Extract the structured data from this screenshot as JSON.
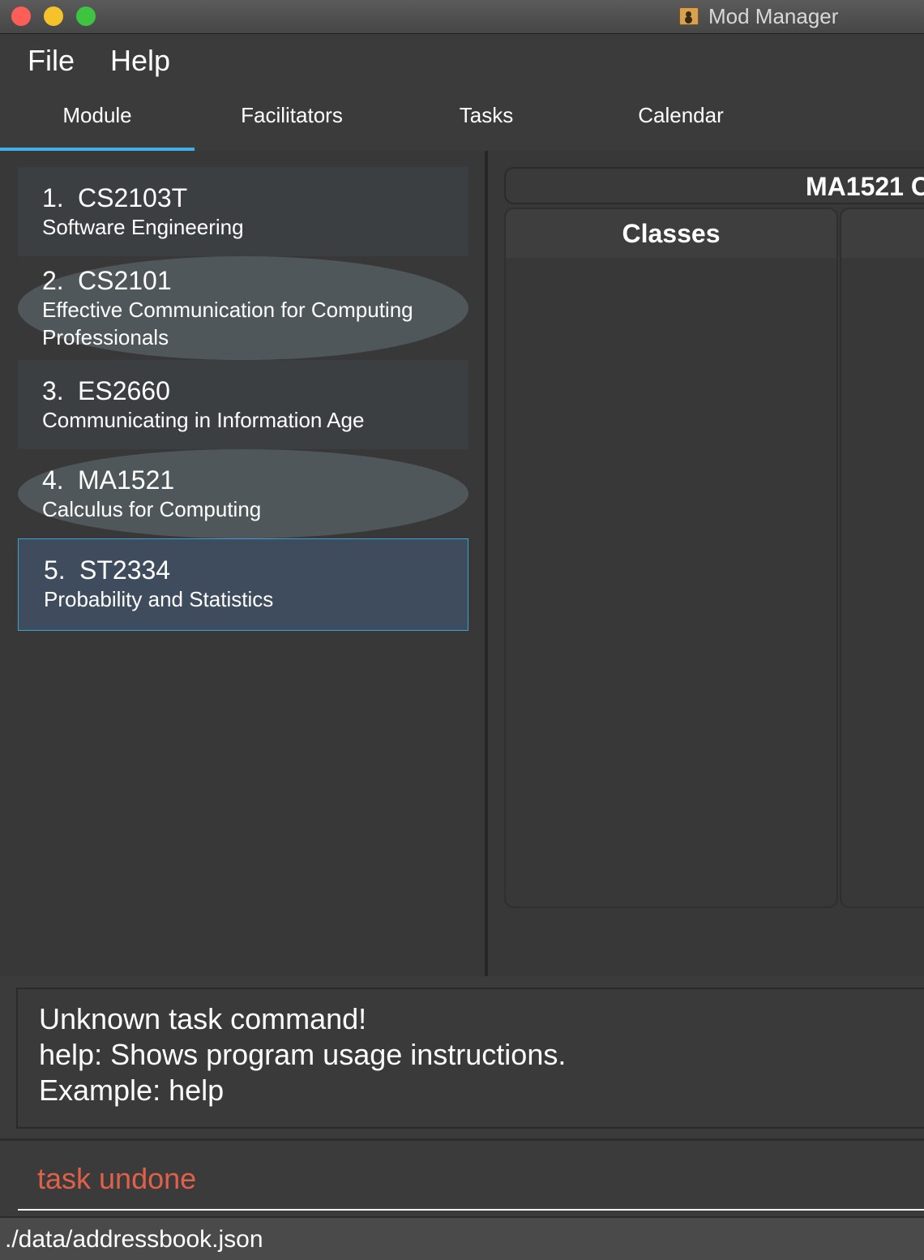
{
  "window": {
    "title": "Mod Manager",
    "app_icon": "contacts-book-icon"
  },
  "menubar": {
    "items": [
      "File",
      "Help"
    ]
  },
  "tabs": [
    {
      "label": "Module",
      "active": true
    },
    {
      "label": "Facilitators",
      "active": false
    },
    {
      "label": "Tasks",
      "active": false
    },
    {
      "label": "Calendar",
      "active": false
    }
  ],
  "module_list": [
    {
      "index": "1.",
      "code": "CS2103T",
      "name": "Software Engineering"
    },
    {
      "index": "2.",
      "code": "CS2101",
      "name": "Effective Communication for Computing Professionals"
    },
    {
      "index": "3.",
      "code": "ES2660",
      "name": "Communicating in Information Age"
    },
    {
      "index": "4.",
      "code": "MA1521",
      "name": "Calculus for Computing"
    },
    {
      "index": "5.",
      "code": "ST2334",
      "name": "Probability and Statistics",
      "selected": true
    }
  ],
  "detail": {
    "header": "MA1521 C",
    "classes_header": "Classes"
  },
  "result": {
    "lines": [
      "Unknown task command!",
      "help: Shows program usage instructions.",
      "Example: help"
    ]
  },
  "command": {
    "value": "task undone",
    "color": "#e0614a"
  },
  "status": {
    "path": "./data/addressbook.json"
  },
  "colors": {
    "accent": "#3fb0e8",
    "selected_border": "#3fa0c8"
  }
}
